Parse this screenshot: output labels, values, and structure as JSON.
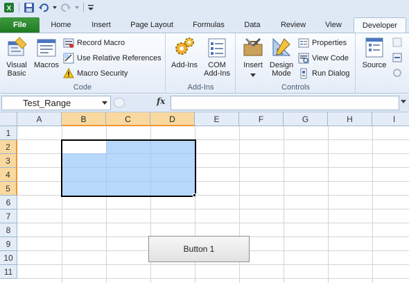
{
  "quick_access": {
    "icons": [
      "excel-logo-icon",
      "save-icon",
      "undo-icon",
      "redo-icon",
      "customize-icon"
    ]
  },
  "tabs": [
    {
      "label": "File"
    },
    {
      "label": "Home"
    },
    {
      "label": "Insert"
    },
    {
      "label": "Page Layout"
    },
    {
      "label": "Formulas"
    },
    {
      "label": "Data"
    },
    {
      "label": "Review"
    },
    {
      "label": "View"
    },
    {
      "label": "Developer"
    }
  ],
  "active_tab": "Developer",
  "ribbon": {
    "code": {
      "label": "Code",
      "visual_basic": "Visual\nBasic",
      "macros": "Macros",
      "record_macro": "Record Macro",
      "use_relative": "Use Relative References",
      "macro_security": "Macro Security"
    },
    "addins": {
      "label": "Add-Ins",
      "addins": "Add-Ins",
      "com_addins": "COM\nAdd-Ins"
    },
    "controls": {
      "label": "Controls",
      "insert": "Insert",
      "design_mode": "Design\nMode",
      "properties": "Properties",
      "view_code": "View Code",
      "run_dialog": "Run Dialog"
    },
    "xml": {
      "source": "Source"
    }
  },
  "formula_bar": {
    "name_box": "Test_Range",
    "fx": "fx",
    "formula": ""
  },
  "sheet": {
    "columns": [
      "A",
      "B",
      "C",
      "D",
      "E",
      "F",
      "G",
      "H",
      "I"
    ],
    "selected_columns": [
      "B",
      "C",
      "D"
    ],
    "rows": [
      "1",
      "2",
      "3",
      "4",
      "5",
      "6",
      "7",
      "8",
      "9",
      "10",
      "11"
    ],
    "selected_rows": [
      "2",
      "3",
      "4",
      "5"
    ],
    "selection": "B2:D5",
    "button_label": "Button 1"
  },
  "colors": {
    "selection_fill": "#b7d7fb",
    "header_highlight": "#f9d99f",
    "file_tab": "#2a8a2e"
  }
}
